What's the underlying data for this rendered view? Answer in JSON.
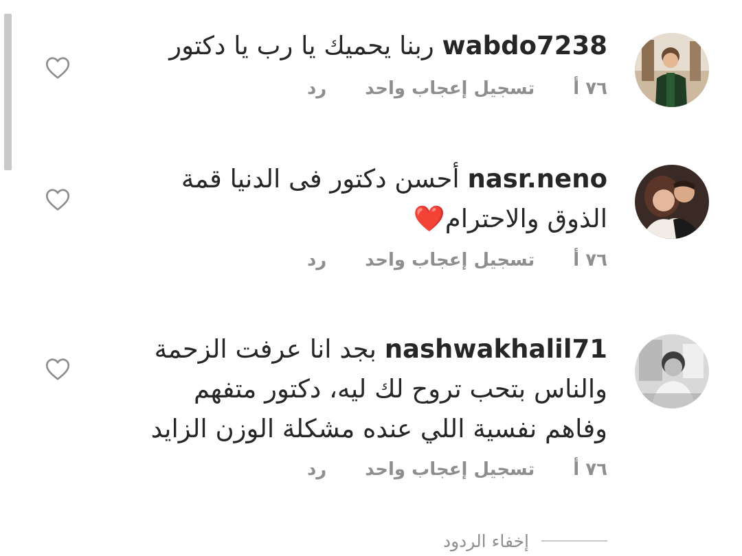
{
  "comments": [
    {
      "username": "wabdo7238",
      "text": "ربنا يحميك يا رب يا دكتور",
      "time": "٧٦ أ",
      "like_label": "تسجيل إعجاب واحد",
      "reply_label": "رد"
    },
    {
      "username": "nasr.neno",
      "text": "أحسن دكتور فى الدنيا قمة الذوق والاحترام❤️",
      "time": "٧٦ أ",
      "like_label": "تسجيل إعجاب واحد",
      "reply_label": "رد"
    },
    {
      "username": "nashwakhalil71",
      "text": "بجد انا عرفت الزحمة والناس بتحب تروح لك ليه، دكتور متفهم وفاهم نفسية اللي عنده مشكلة الوزن الزايد",
      "time": "٧٦ أ",
      "like_label": "تسجيل إعجاب واحد",
      "reply_label": "رد"
    }
  ],
  "hide_replies_label": "إخفاء الردود",
  "icons": {
    "like": "heart-outline-icon"
  },
  "colors": {
    "text": "#262626",
    "secondary": "#8e8e8e"
  }
}
